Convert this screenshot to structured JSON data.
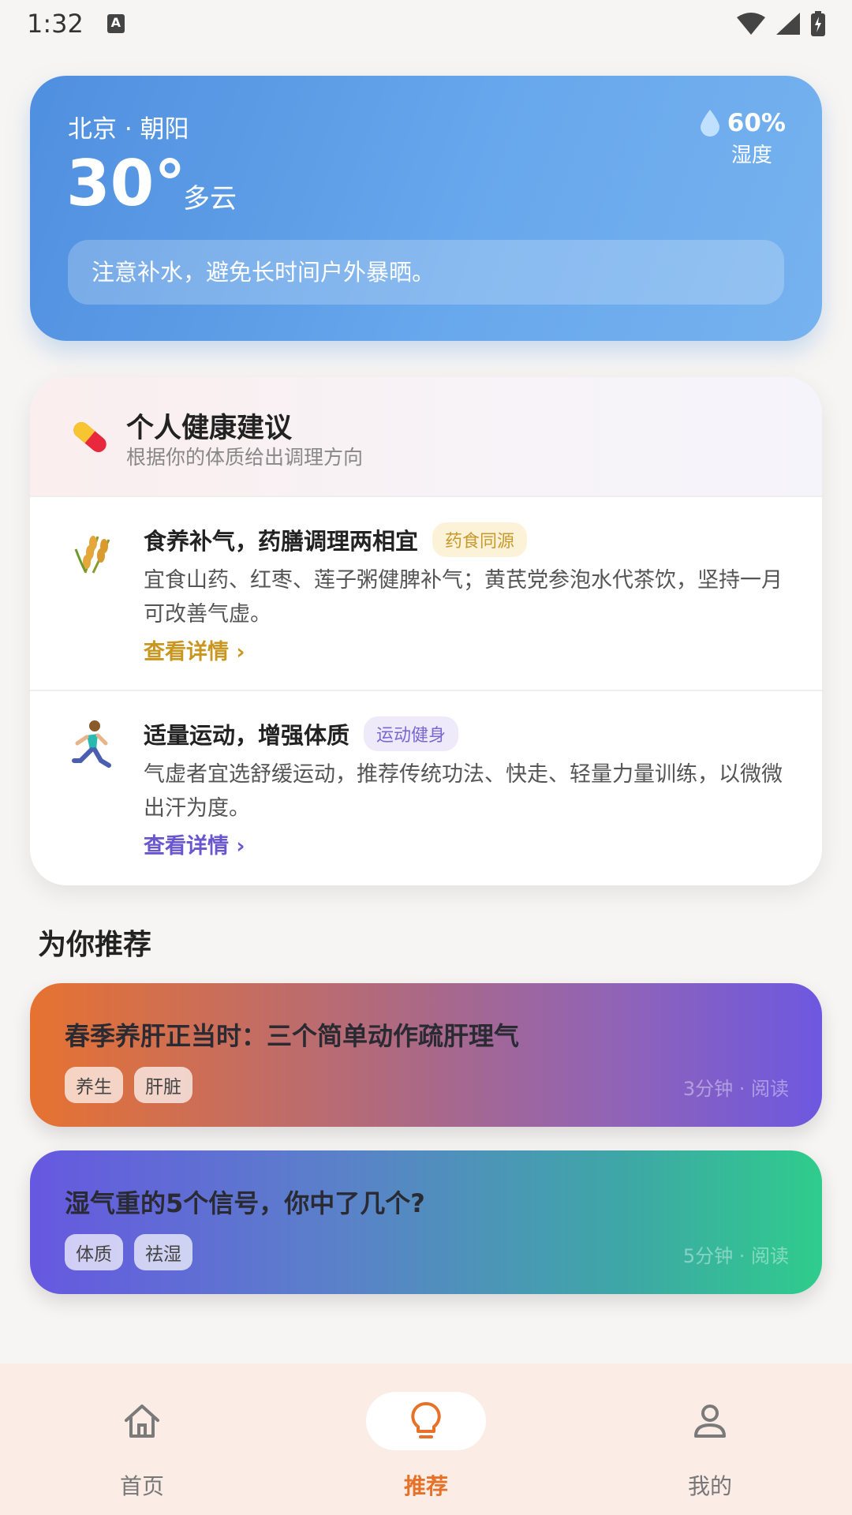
{
  "status_bar": {
    "time": "1:32",
    "a_badge": "A"
  },
  "weather": {
    "location": "北京 · 朝阳",
    "temperature": "30°",
    "condition": "多云",
    "humidity_value": "60%",
    "humidity_label": "湿度",
    "tip": "注意补水，避免长时间户外暴晒。"
  },
  "health": {
    "title": "个人健康建议",
    "subtitle": "根据你的体质给出调理方向",
    "items": [
      {
        "title": "食养补气，药膳调理两相宜",
        "tag": "药食同源",
        "desc": "宜食山药、红枣、莲子粥健脾补气；黄芪党参泡水代茶饮，坚持一月可改善气虚。",
        "more": "查看详情 ›"
      },
      {
        "title": "适量运动，增强体质",
        "tag": "运动健身",
        "desc": "气虚者宜选舒缓运动，推荐传统功法、快走、轻量力量训练，以微微出汗为度。",
        "more": "查看详情 ›"
      }
    ]
  },
  "recommend": {
    "section_title": "为你推荐",
    "cards": [
      {
        "title": "春季养肝正当时：三个简单动作疏肝理气",
        "tags": [
          "养生",
          "肝脏"
        ],
        "meta": "3分钟 · 阅读"
      },
      {
        "title": "湿气重的5个信号，你中了几个?",
        "tags": [
          "体质",
          "祛湿"
        ],
        "meta": "5分钟 · 阅读"
      }
    ]
  },
  "nav": {
    "items": [
      {
        "label": "首页",
        "icon": "home-icon"
      },
      {
        "label": "推荐",
        "icon": "lightbulb-icon"
      },
      {
        "label": "我的",
        "icon": "person-icon"
      }
    ],
    "active_index": 1
  }
}
